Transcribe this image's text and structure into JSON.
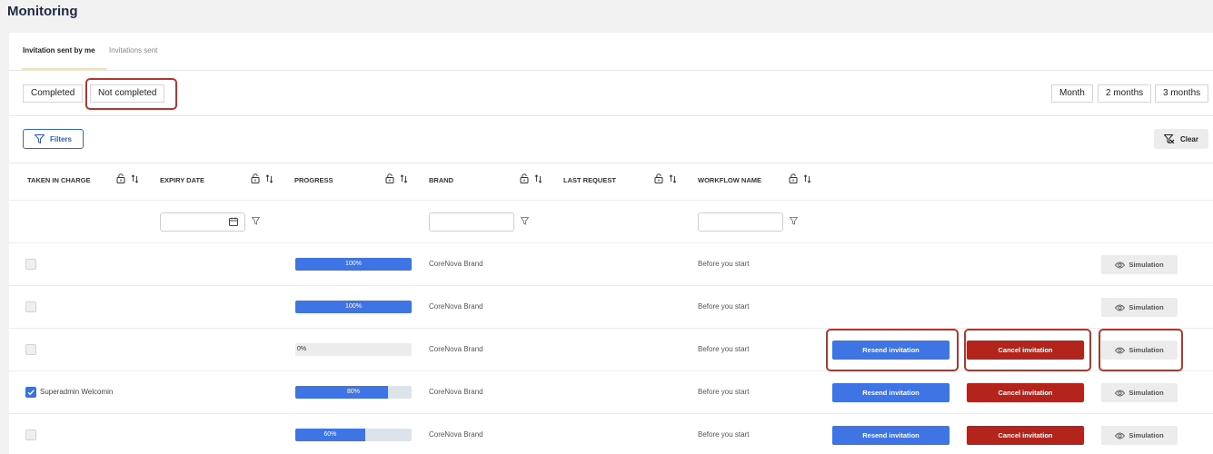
{
  "page": {
    "title": "Monitoring"
  },
  "tabs": [
    {
      "label": "Invitation sent by me",
      "active": true
    },
    {
      "label": "Invitations sent",
      "active": false
    }
  ],
  "status_filter": {
    "options": [
      "Completed",
      "Not completed"
    ],
    "selected": "Not completed"
  },
  "period_filter": {
    "options": [
      "Month",
      "2 months",
      "3 months"
    ]
  },
  "toolbar": {
    "filters_label": "Filters",
    "clear_label": "Clear"
  },
  "columns": [
    {
      "label": "TAKEN IN CHARGE"
    },
    {
      "label": "EXPIRY DATE"
    },
    {
      "label": "PROGRESS"
    },
    {
      "label": "BRAND"
    },
    {
      "label": "LAST REQUEST"
    },
    {
      "label": "WORKFLOW NAME"
    }
  ],
  "column_filters": {
    "expiry_date": "",
    "brand": "",
    "workflow_name": ""
  },
  "rows": [
    {
      "taken": false,
      "taken_label": "",
      "progress": 100,
      "progress_label": "100%",
      "brand": "CoreNova Brand",
      "workflow": "Before you start",
      "resend": false,
      "cancel": false,
      "simulation": "Simulation"
    },
    {
      "taken": false,
      "taken_label": "",
      "progress": 100,
      "progress_label": "100%",
      "brand": "CoreNova Brand",
      "workflow": "Before you start",
      "resend": false,
      "cancel": false,
      "simulation": "Simulation"
    },
    {
      "taken": false,
      "taken_label": "",
      "progress": 0,
      "progress_label": "0%",
      "brand": "CoreNova Brand",
      "workflow": "Before you start",
      "resend": true,
      "cancel": true,
      "simulation": "Simulation"
    },
    {
      "taken": true,
      "taken_label": "Superadmin Welcomin",
      "progress": 80,
      "progress_label": "80%",
      "brand": "CoreNova Brand",
      "workflow": "Before you start",
      "resend": true,
      "cancel": true,
      "simulation": "Simulation"
    },
    {
      "taken": false,
      "taken_label": "",
      "progress": 60,
      "progress_label": "60%",
      "brand": "CoreNova Brand",
      "workflow": "Before you start",
      "resend": true,
      "cancel": true,
      "simulation": "Simulation"
    }
  ],
  "actions": {
    "resend_label": "Resend invitation",
    "cancel_label": "Cancel invitation"
  },
  "colors": {
    "primary": "#3f74e4",
    "danger": "#b3251c",
    "highlight": "#b7352d",
    "tab_accent": "#f1e4a8"
  },
  "icons": [
    "filter-icon",
    "clear-filter-icon",
    "lock-icon",
    "sort-icon",
    "calendar-icon",
    "funnel-icon",
    "eye-icon",
    "check-icon"
  ]
}
